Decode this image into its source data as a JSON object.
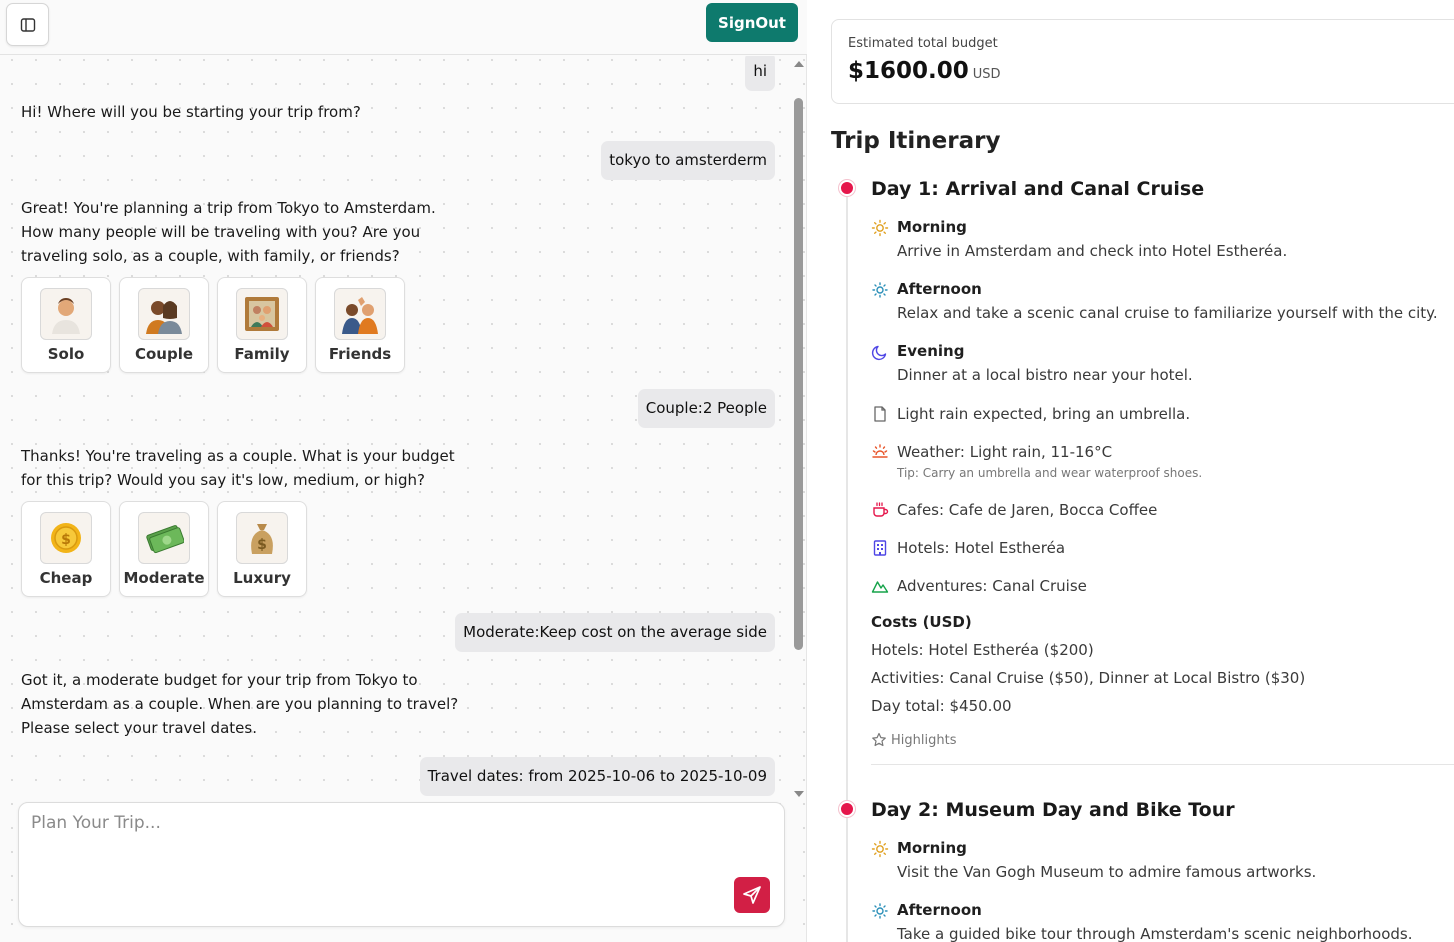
{
  "header": {
    "signout_label": "SignOut"
  },
  "chat": {
    "messages": [
      {
        "role": "user",
        "text": "hi"
      },
      {
        "role": "assistant",
        "lines": [
          "Hi! Where will you be starting your trip from?"
        ]
      },
      {
        "role": "user",
        "text": "tokyo to amsterderm"
      },
      {
        "role": "assistant",
        "lines": [
          "Great! You're planning a trip from Tokyo to Amsterdam.",
          "How many people will be traveling with you? Are you",
          "traveling solo, as a couple, with family, or friends?"
        ]
      },
      {
        "role": "user",
        "text": "Couple:2 People"
      },
      {
        "role": "assistant",
        "lines": [
          "Thanks! You're traveling as a couple. What is your budget",
          "for this trip? Would you say it's low, medium, or high?"
        ]
      },
      {
        "role": "user",
        "text": "Moderate:Keep cost on the average side"
      },
      {
        "role": "assistant",
        "lines": [
          "Got it, a moderate budget for your trip from Tokyo to",
          "Amsterdam as a couple. When are you planning to travel?",
          "Please select your travel dates."
        ]
      },
      {
        "role": "user",
        "text": "Travel dates: from 2025-10-06 to 2025-10-09"
      }
    ],
    "group_options": [
      {
        "label": "Solo",
        "icon": "person-icon"
      },
      {
        "label": "Couple",
        "icon": "couple-icon"
      },
      {
        "label": "Family",
        "icon": "family-icon"
      },
      {
        "label": "Friends",
        "icon": "friends-icon"
      }
    ],
    "budget_options": [
      {
        "label": "Cheap",
        "icon": "coin-icon"
      },
      {
        "label": "Moderate",
        "icon": "cash-icon"
      },
      {
        "label": "Luxury",
        "icon": "money-bag-icon"
      }
    ],
    "input_placeholder": "Plan Your Trip..."
  },
  "budget": {
    "label": "Estimated total budget",
    "amount": "$1600.00",
    "currency": "USD"
  },
  "itinerary": {
    "title": "Trip Itinerary",
    "days": [
      {
        "title": "Day 1: Arrival and Canal Cruise",
        "morning": {
          "label": "Morning",
          "text": "Arrive in Amsterdam and check into Hotel Estheréa."
        },
        "afternoon": {
          "label": "Afternoon",
          "text": "Relax and take a scenic canal cruise to familiarize yourself with the city."
        },
        "evening": {
          "label": "Evening",
          "text": "Dinner at a local bistro near your hotel."
        },
        "note": "Light rain expected, bring an umbrella.",
        "weather": "Weather: Light rain, 11-16°C",
        "weather_tip": "Tip: Carry an umbrella and wear waterproof shoes.",
        "cafes": "Cafes: Cafe de Jaren, Bocca Coffee",
        "hotels": "Hotels: Hotel Estheréa",
        "adventures": "Adventures: Canal Cruise",
        "costs_title": "Costs (USD)",
        "cost_hotels": "Hotels: Hotel Estheréa ($200)",
        "cost_activities": "Activities: Canal Cruise ($50), Dinner at Local Bistro ($30)",
        "day_total": "Day total: $450.00",
        "highlights_label": "Highlights"
      },
      {
        "title": "Day 2: Museum Day and Bike Tour",
        "morning": {
          "label": "Morning",
          "text": "Visit the Van Gogh Museum to admire famous artworks."
        },
        "afternoon": {
          "label": "Afternoon",
          "text": "Take a guided bike tour through Amsterdam's scenic neighborhoods."
        }
      }
    ]
  },
  "colors": {
    "signout": "#0e7a6d",
    "send": "#d21f45",
    "timeline_dot": "#e5164b",
    "sun_icon": "#e0a020",
    "afternoon_icon": "#2a8fb8",
    "evening_icon": "#4f46e5"
  }
}
